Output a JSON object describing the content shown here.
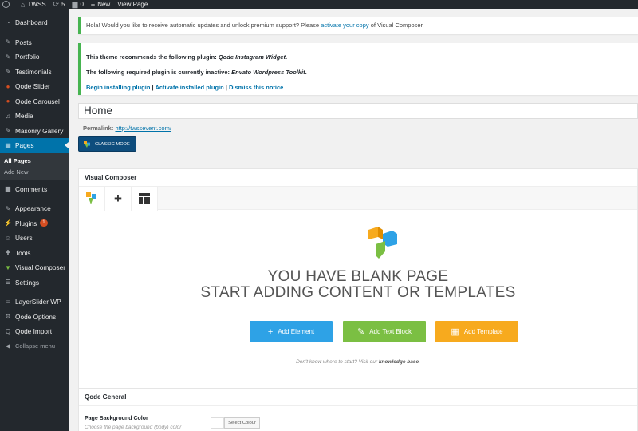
{
  "adminbar": {
    "site_name": "TWSS",
    "updates_count": "5",
    "comments_count": "0",
    "new_label": "New",
    "view_page_label": "View Page"
  },
  "sidebar": {
    "items": [
      {
        "label": "Dashboard",
        "icon": "dashboard-icon"
      },
      {
        "label": "Posts",
        "icon": "pin-icon"
      },
      {
        "label": "Portfolio",
        "icon": "pin-icon"
      },
      {
        "label": "Testimonials",
        "icon": "pin-icon"
      },
      {
        "label": "Qode Slider",
        "icon": "qode-icon"
      },
      {
        "label": "Qode Carousel",
        "icon": "qode-icon"
      },
      {
        "label": "Media",
        "icon": "media-icon"
      },
      {
        "label": "Masonry Gallery",
        "icon": "pin-icon"
      },
      {
        "label": "Pages",
        "icon": "pages-icon"
      },
      {
        "label": "Comments",
        "icon": "comment-icon"
      },
      {
        "label": "Appearance",
        "icon": "brush-icon"
      },
      {
        "label": "Plugins",
        "icon": "plugin-icon",
        "badge": "1"
      },
      {
        "label": "Users",
        "icon": "user-icon"
      },
      {
        "label": "Tools",
        "icon": "wrench-icon"
      },
      {
        "label": "Visual Composer",
        "icon": "vc-icon"
      },
      {
        "label": "Settings",
        "icon": "settings-icon"
      },
      {
        "label": "LayerSlider WP",
        "icon": "layers-icon"
      },
      {
        "label": "Qode Options",
        "icon": "gear-icon"
      },
      {
        "label": "Qode Import",
        "icon": "import-icon"
      }
    ],
    "submenu": [
      "All Pages",
      "Add New"
    ],
    "collapse_label": "Collapse menu"
  },
  "notices": {
    "vc_text_before": "Hola! Would you like to receive automatic updates and unlock premium support? Please ",
    "vc_link": "activate your copy",
    "vc_text_after": " of Visual Composer.",
    "plugin_line1_before": "This theme recommends the following plugin: ",
    "plugin_line1_name": "Qode Instagram Widget",
    "plugin_line1_after": ".",
    "plugin_line2_before": "The following required plugin is currently inactive: ",
    "plugin_line2_name": "Envato Wordpress Toolkit",
    "plugin_line2_after": ".",
    "action_install": "Begin installing plugin",
    "action_activate": "Activate installed plugin",
    "action_dismiss": "Dismiss this notice",
    "separator": "|"
  },
  "editor": {
    "page_title": "Home",
    "permalink_label": "Permalink:",
    "permalink_url": "http://twssevent.com/",
    "classic_mode_label": "CLASSIC MODE"
  },
  "visual_composer": {
    "title": "Visual Composer",
    "blank_line1": "YOU HAVE BLANK PAGE",
    "blank_line2": "START ADDING CONTENT OR TEMPLATES",
    "add_element": "Add Element",
    "add_text_block": "Add Text Block",
    "add_template": "Add Template",
    "help_text": "Don't know where to start? Visit our ",
    "help_link": "knowledge base",
    "help_end": ".",
    "colors": {
      "element": "#2ea2e6",
      "text_block": "#7bbf43",
      "template": "#f7aa1e"
    }
  },
  "qode_general": {
    "title": "Qode General",
    "bg_color_label": "Page Background Color",
    "bg_color_desc": "Choose the page background (body) color",
    "select_colour": "Select Colour"
  },
  "colors": {
    "admin_dark": "#23282d",
    "active_blue": "#0073aa",
    "notice_green": "#46b450"
  }
}
